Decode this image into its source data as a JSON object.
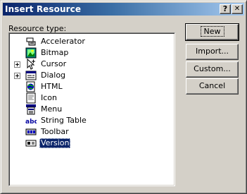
{
  "dialog": {
    "title": "Insert Resource",
    "help_button": "?",
    "close_button": "✕"
  },
  "resource_type_label": "Resource type:",
  "resources": [
    {
      "label": "Accelerator",
      "icon": "accelerator-icon",
      "expandable": false,
      "selected": false
    },
    {
      "label": "Bitmap",
      "icon": "bitmap-icon",
      "expandable": false,
      "selected": false
    },
    {
      "label": "Cursor",
      "icon": "cursor-icon",
      "expandable": true,
      "selected": false
    },
    {
      "label": "Dialog",
      "icon": "dialog-icon",
      "expandable": true,
      "selected": false
    },
    {
      "label": "HTML",
      "icon": "html-icon",
      "expandable": false,
      "selected": false
    },
    {
      "label": "Icon",
      "icon": "icon-resource-icon",
      "expandable": false,
      "selected": false
    },
    {
      "label": "Menu",
      "icon": "menu-icon",
      "expandable": false,
      "selected": false
    },
    {
      "label": "String Table",
      "icon": "string-table-icon",
      "expandable": false,
      "selected": false
    },
    {
      "label": "Toolbar",
      "icon": "toolbar-icon",
      "expandable": false,
      "selected": false
    },
    {
      "label": "Version",
      "icon": "version-icon",
      "expandable": false,
      "selected": true
    }
  ],
  "buttons": {
    "new": "New",
    "import": "Import...",
    "custom": "Custom...",
    "cancel": "Cancel"
  },
  "icon_glyphs": {
    "string_table": "abc"
  },
  "colors": {
    "titlebar_start": "#0a246a",
    "titlebar_end": "#a6caf0",
    "selection": "#0a246a",
    "face": "#d4d0c8"
  }
}
